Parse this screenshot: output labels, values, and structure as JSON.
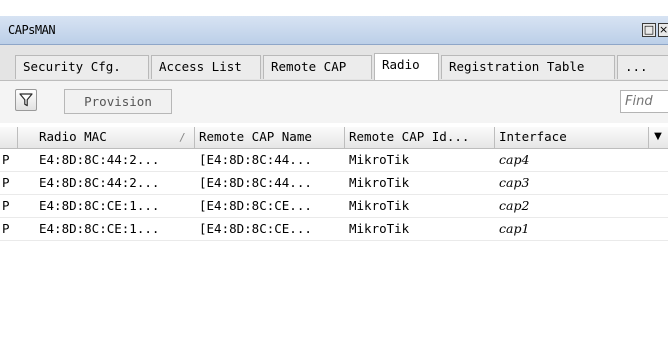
{
  "window": {
    "title": "CAPsMAN",
    "restore_glyph": "□",
    "close_glyph": "×"
  },
  "tabs": [
    {
      "label": "Security Cfg.",
      "active": false
    },
    {
      "label": "Access List",
      "active": false
    },
    {
      "label": "Remote CAP",
      "active": false
    },
    {
      "label": "Radio",
      "active": true
    },
    {
      "label": "Registration Table",
      "active": false
    },
    {
      "label": "...",
      "active": false
    }
  ],
  "toolbar": {
    "filter_icon": "funnel-icon",
    "provision_label": "Provision",
    "find_placeholder": "Find"
  },
  "table": {
    "columns": [
      "Radio MAC",
      "Remote CAP Name",
      "Remote CAP Id...",
      "Interface"
    ],
    "sort_indicator": "/",
    "column_menu_icon": "▼",
    "rows": [
      {
        "flag": "P",
        "radio_mac": "E4:8D:8C:44:2...",
        "remote_cap_name": "[E4:8D:8C:44...",
        "remote_cap_id": "MikroTik",
        "interface": "cap4"
      },
      {
        "flag": "P",
        "radio_mac": "E4:8D:8C:44:2...",
        "remote_cap_name": "[E4:8D:8C:44...",
        "remote_cap_id": "MikroTik",
        "interface": "cap3"
      },
      {
        "flag": "P",
        "radio_mac": "E4:8D:8C:CE:1...",
        "remote_cap_name": "[E4:8D:8C:CE...",
        "remote_cap_id": "MikroTik",
        "interface": "cap2"
      },
      {
        "flag": "P",
        "radio_mac": "E4:8D:8C:CE:1...",
        "remote_cap_name": "[E4:8D:8C:CE...",
        "remote_cap_id": "MikroTik",
        "interface": "cap1"
      }
    ]
  },
  "colors": {
    "titlebar": "#c6d6ec",
    "tab_strip": "#e4e4e4",
    "header": "#ececec"
  }
}
